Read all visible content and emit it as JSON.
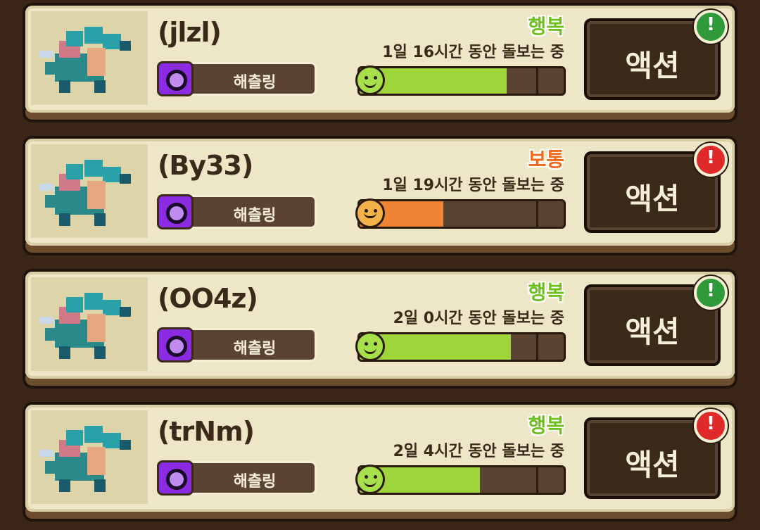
{
  "trait_label": "해츨링",
  "action_label": "액션",
  "colors": {
    "happy_text": "#6fbf1f",
    "happy_bar": "#9ed53a",
    "normal_text": "#ef6a1a",
    "normal_bar": "#f08434",
    "happy_face": "#a6e04a",
    "normal_face": "#f4b24a",
    "alert_green": "#2e9a3a",
    "alert_red": "#e02a2a"
  },
  "cards": [
    {
      "name": "(jlzl)",
      "mood": "행복",
      "mood_type": "happy",
      "care_time": "1일 16시간 동안 돌보는 중",
      "level": 0.72,
      "alert": "green",
      "alert_glyph": "!"
    },
    {
      "name": "(By33)",
      "mood": "보통",
      "mood_type": "normal",
      "care_time": "1일 19시간 동안 돌보는 중",
      "level": 0.41,
      "alert": "red",
      "alert_glyph": "!"
    },
    {
      "name": "(OO4z)",
      "mood": "행복",
      "mood_type": "happy",
      "care_time": "2일 0시간 동안 돌보는 중",
      "level": 0.74,
      "alert": "green",
      "alert_glyph": "!"
    },
    {
      "name": "(trNm)",
      "mood": "행복",
      "mood_type": "happy",
      "care_time": "2일 4시간 동안 돌보는 중",
      "level": 0.59,
      "alert": "red",
      "alert_glyph": "!"
    }
  ]
}
